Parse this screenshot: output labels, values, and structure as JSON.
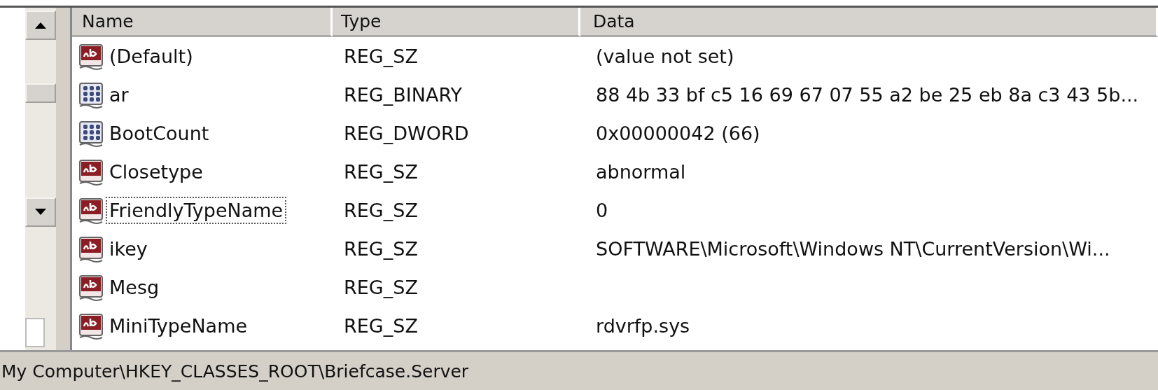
{
  "table": {
    "columns": [
      "Name",
      "Type",
      "Data"
    ],
    "rows": [
      {
        "kind": "string",
        "name": "(Default)",
        "type": "REG_SZ",
        "data": "(value not set)",
        "focused": false
      },
      {
        "kind": "binary",
        "name": "ar",
        "type": "REG_BINARY",
        "data": "88 4b 33 bf c5 16 69 67 07 55 a2 be 25 eb 8a c3 43 5b...",
        "focused": false
      },
      {
        "kind": "binary",
        "name": "BootCount",
        "type": "REG_DWORD",
        "data": "0x00000042 (66)",
        "focused": false
      },
      {
        "kind": "string",
        "name": "Closetype",
        "type": "REG_SZ",
        "data": "abnormal",
        "focused": false
      },
      {
        "kind": "string",
        "name": "FriendlyTypeName",
        "type": "REG_SZ",
        "data": "0",
        "focused": true
      },
      {
        "kind": "string",
        "name": "ikey",
        "type": "REG_SZ",
        "data": "SOFTWARE\\Microsoft\\Windows NT\\CurrentVersion\\Wi...",
        "focused": false
      },
      {
        "kind": "string",
        "name": "Mesg",
        "type": "REG_SZ",
        "focused": false
      },
      {
        "kind": "string",
        "name": "MiniTypeName",
        "type": "REG_SZ",
        "data": "rdvrfp.sys",
        "focused": false
      }
    ]
  },
  "status_bar": "My Computer\\HKEY_CLASSES_ROOT\\Briefcase.Server"
}
